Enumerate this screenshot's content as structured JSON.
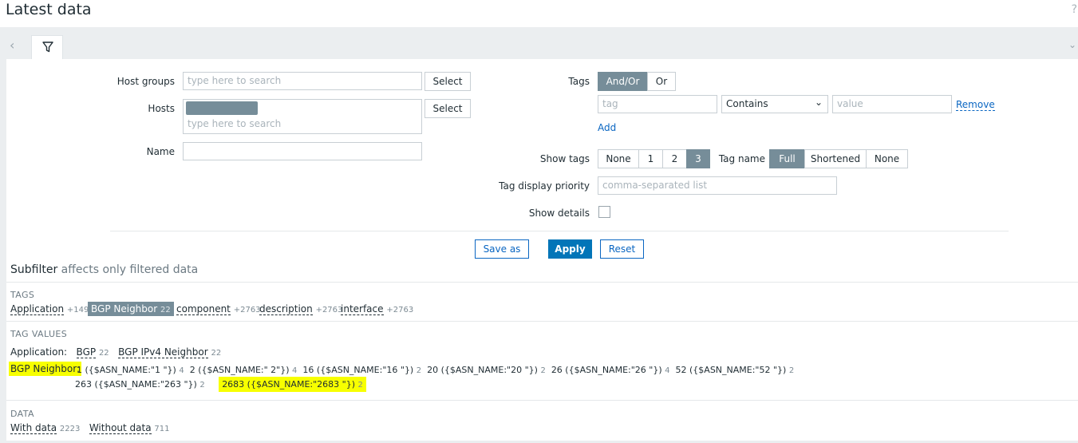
{
  "header": {
    "title": "Latest data",
    "help": "?"
  },
  "filter": {
    "host_groups_label": "Host groups",
    "host_groups_placeholder": "type here to search",
    "hosts_label": "Hosts",
    "hosts_placeholder": "type here to search",
    "name_label": "Name",
    "select_label": "Select",
    "tags_label": "Tags",
    "and_or": "And/Or",
    "or": "Or",
    "tag_placeholder": "tag",
    "operator_value": "Contains",
    "value_placeholder": "value",
    "remove": "Remove",
    "add": "Add",
    "show_tags_label": "Show tags",
    "show_tags_options": [
      "None",
      "1",
      "2",
      "3"
    ],
    "tag_name_label": "Tag name",
    "tag_name_options": [
      "Full",
      "Shortened",
      "None"
    ],
    "tag_priority_label": "Tag display priority",
    "tag_priority_placeholder": "comma-separated list",
    "show_details_label": "Show details",
    "save_as": "Save as",
    "apply": "Apply",
    "reset": "Reset"
  },
  "subfilter": {
    "title": "Subfilter",
    "note": "affects only filtered data",
    "tags_header": "TAGS",
    "tags": [
      {
        "name": "Application",
        "count": "+149"
      },
      {
        "name": "BGP Neighbor",
        "count": "22"
      },
      {
        "name": "component",
        "count": "+2763"
      },
      {
        "name": "description",
        "count": "+2763"
      },
      {
        "name": "interface",
        "count": "+2763"
      }
    ],
    "tag_values_header": "TAG VALUES",
    "application_label": "Application:",
    "application_values": [
      {
        "name": "BGP",
        "count": "22"
      },
      {
        "name": "BGP IPv4 Neighbor",
        "count": "22"
      }
    ],
    "bgp_label": "BGP Neighbor:",
    "bgp_values": [
      {
        "name": "1 ({$ASN_NAME:\"1 \"})",
        "count": "4"
      },
      {
        "name": "2 ({$ASN_NAME:\" 2\"})",
        "count": "4"
      },
      {
        "name": "16 ({$ASN_NAME:\"16 \"})",
        "count": "2"
      },
      {
        "name": "20 ({$ASN_NAME:\"20 \"})",
        "count": "2"
      },
      {
        "name": "26 ({$ASN_NAME:\"26 \"})",
        "count": "4"
      },
      {
        "name": "52 ({$ASN_NAME:\"52 \"})",
        "count": "2"
      },
      {
        "name": "263 ({$ASN_NAME:\"263 \"})",
        "count": "2"
      },
      {
        "name": "2683 ({$ASN_NAME:\"2683 \"})",
        "count": "2"
      }
    ],
    "data_header": "DATA",
    "data": [
      {
        "name": "With data",
        "count": "2223"
      },
      {
        "name": "Without data",
        "count": "711"
      }
    ]
  }
}
